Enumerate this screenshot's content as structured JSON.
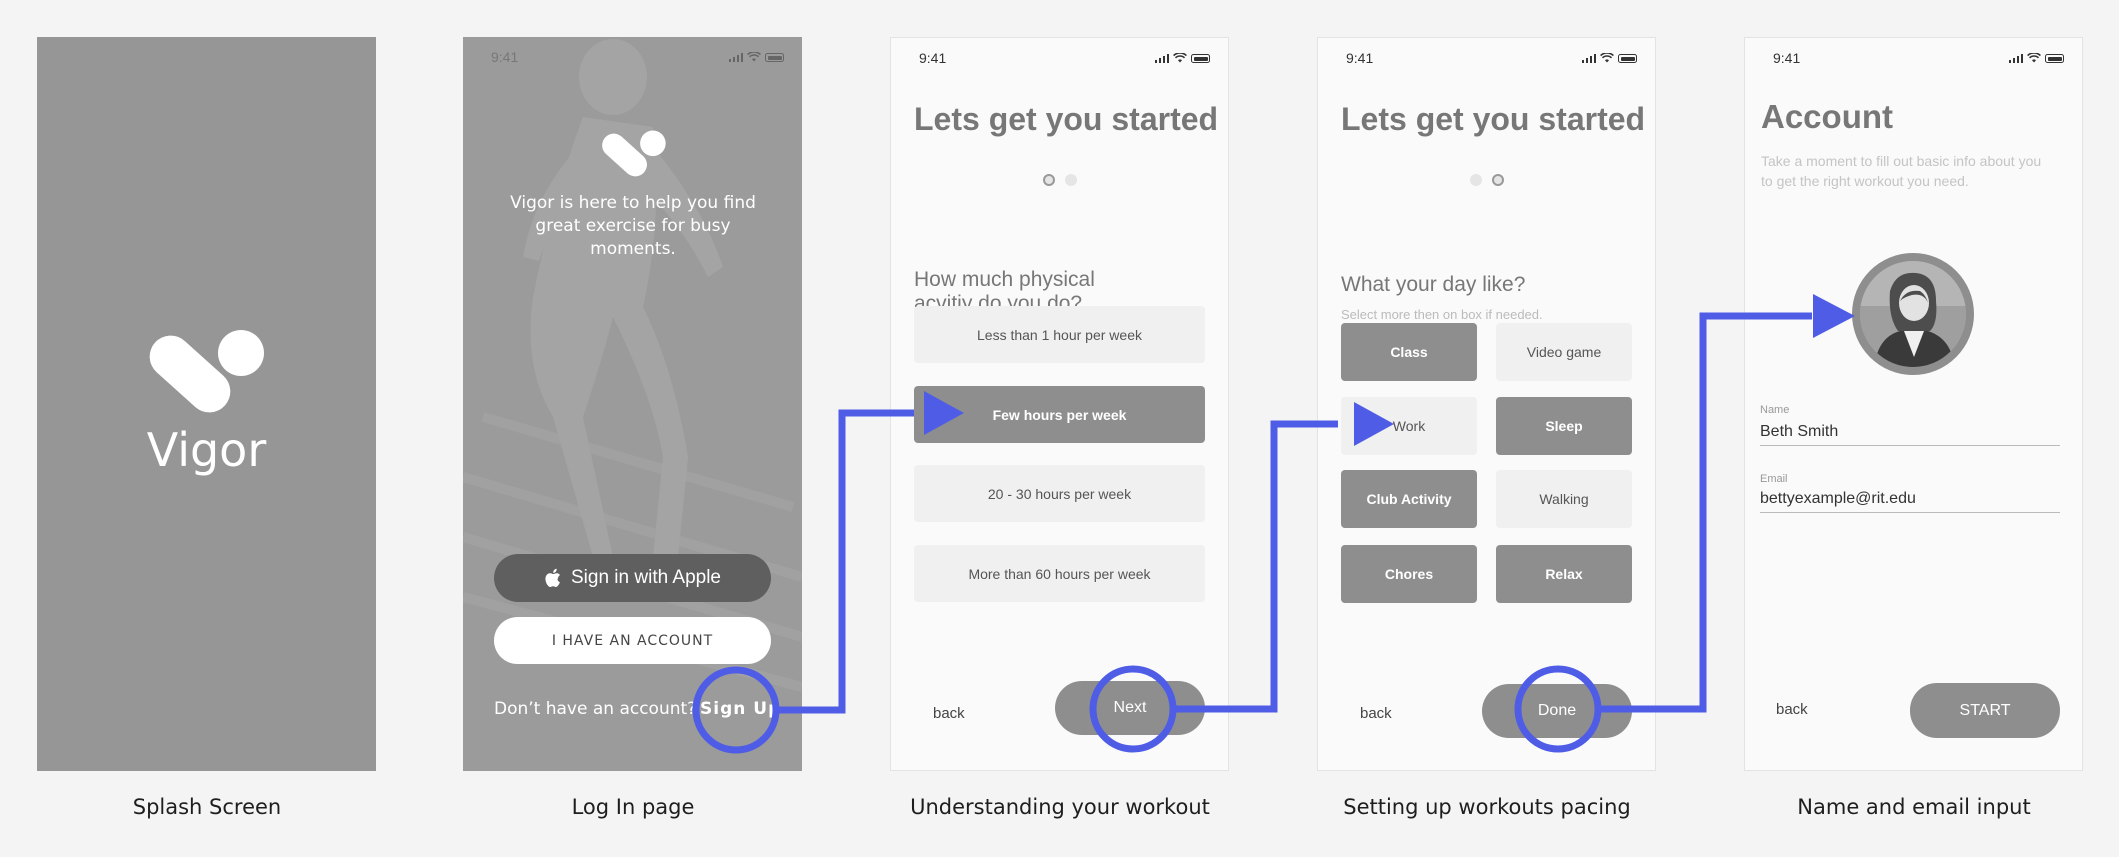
{
  "status_time": "9:41",
  "splash": {
    "app_name": "Vigor",
    "caption": "Splash Screen"
  },
  "login": {
    "tagline": "Vigor is here to help you find great exercise for busy moments.",
    "apple_button": "Sign in with Apple",
    "account_button": "I HAVE AN ACCOUNT",
    "no_account_text": "Don’t have an account?",
    "signup_link": "Sign Up",
    "caption": "Log In page"
  },
  "workout": {
    "title": "Lets get you started",
    "question": "How much physical acvitiy do you do?",
    "options": [
      {
        "label": "Less than 1 hour per week",
        "selected": false
      },
      {
        "label": "Few hours per week",
        "selected": true
      },
      {
        "label": "20 - 30 hours per week",
        "selected": false
      },
      {
        "label": "More than 60 hours per week",
        "selected": false
      }
    ],
    "back": "back",
    "next": "Next",
    "caption": "Understanding your workout"
  },
  "pacing": {
    "title": "Lets get you started",
    "question": "What your day like?",
    "hint": "Select more then on box if needed.",
    "chips": [
      {
        "label": "Class",
        "selected": true
      },
      {
        "label": "Video game",
        "selected": false
      },
      {
        "label": "Work",
        "selected": false
      },
      {
        "label": "Sleep",
        "selected": true
      },
      {
        "label": "Club Activity",
        "selected": true
      },
      {
        "label": "Walking",
        "selected": false
      },
      {
        "label": "Chores",
        "selected": true
      },
      {
        "label": "Relax",
        "selected": true
      }
    ],
    "back": "back",
    "done": "Done",
    "caption": "Setting up workouts pacing"
  },
  "account": {
    "title": "Account",
    "description": "Take a moment to fill out basic info about you to get the right workout you need.",
    "name_label": "Name",
    "name_value": "Beth Smith",
    "email_label": "Email",
    "email_value": "bettyexample@rit.edu",
    "back": "back",
    "start": "START",
    "caption": "Name and email input"
  },
  "colors": {
    "flow_arrow": "#4f5de6",
    "selected_fill": "#8e8e8e",
    "unselected_fill": "#f0f0f0"
  }
}
